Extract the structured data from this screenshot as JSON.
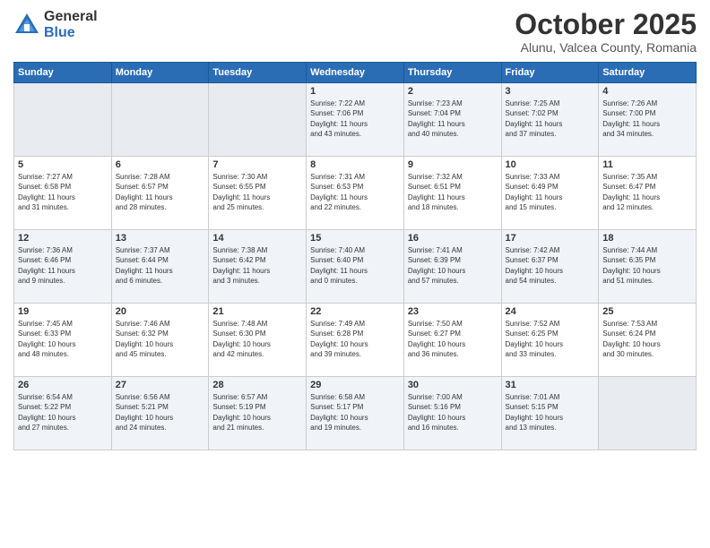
{
  "header": {
    "logo_general": "General",
    "logo_blue": "Blue",
    "month_title": "October 2025",
    "location": "Alunu, Valcea County, Romania"
  },
  "weekdays": [
    "Sunday",
    "Monday",
    "Tuesday",
    "Wednesday",
    "Thursday",
    "Friday",
    "Saturday"
  ],
  "weeks": [
    [
      {
        "day": "",
        "info": ""
      },
      {
        "day": "",
        "info": ""
      },
      {
        "day": "",
        "info": ""
      },
      {
        "day": "1",
        "info": "Sunrise: 7:22 AM\nSunset: 7:06 PM\nDaylight: 11 hours\nand 43 minutes."
      },
      {
        "day": "2",
        "info": "Sunrise: 7:23 AM\nSunset: 7:04 PM\nDaylight: 11 hours\nand 40 minutes."
      },
      {
        "day": "3",
        "info": "Sunrise: 7:25 AM\nSunset: 7:02 PM\nDaylight: 11 hours\nand 37 minutes."
      },
      {
        "day": "4",
        "info": "Sunrise: 7:26 AM\nSunset: 7:00 PM\nDaylight: 11 hours\nand 34 minutes."
      }
    ],
    [
      {
        "day": "5",
        "info": "Sunrise: 7:27 AM\nSunset: 6:58 PM\nDaylight: 11 hours\nand 31 minutes."
      },
      {
        "day": "6",
        "info": "Sunrise: 7:28 AM\nSunset: 6:57 PM\nDaylight: 11 hours\nand 28 minutes."
      },
      {
        "day": "7",
        "info": "Sunrise: 7:30 AM\nSunset: 6:55 PM\nDaylight: 11 hours\nand 25 minutes."
      },
      {
        "day": "8",
        "info": "Sunrise: 7:31 AM\nSunset: 6:53 PM\nDaylight: 11 hours\nand 22 minutes."
      },
      {
        "day": "9",
        "info": "Sunrise: 7:32 AM\nSunset: 6:51 PM\nDaylight: 11 hours\nand 18 minutes."
      },
      {
        "day": "10",
        "info": "Sunrise: 7:33 AM\nSunset: 6:49 PM\nDaylight: 11 hours\nand 15 minutes."
      },
      {
        "day": "11",
        "info": "Sunrise: 7:35 AM\nSunset: 6:47 PM\nDaylight: 11 hours\nand 12 minutes."
      }
    ],
    [
      {
        "day": "12",
        "info": "Sunrise: 7:36 AM\nSunset: 6:46 PM\nDaylight: 11 hours\nand 9 minutes."
      },
      {
        "day": "13",
        "info": "Sunrise: 7:37 AM\nSunset: 6:44 PM\nDaylight: 11 hours\nand 6 minutes."
      },
      {
        "day": "14",
        "info": "Sunrise: 7:38 AM\nSunset: 6:42 PM\nDaylight: 11 hours\nand 3 minutes."
      },
      {
        "day": "15",
        "info": "Sunrise: 7:40 AM\nSunset: 6:40 PM\nDaylight: 11 hours\nand 0 minutes."
      },
      {
        "day": "16",
        "info": "Sunrise: 7:41 AM\nSunset: 6:39 PM\nDaylight: 10 hours\nand 57 minutes."
      },
      {
        "day": "17",
        "info": "Sunrise: 7:42 AM\nSunset: 6:37 PM\nDaylight: 10 hours\nand 54 minutes."
      },
      {
        "day": "18",
        "info": "Sunrise: 7:44 AM\nSunset: 6:35 PM\nDaylight: 10 hours\nand 51 minutes."
      }
    ],
    [
      {
        "day": "19",
        "info": "Sunrise: 7:45 AM\nSunset: 6:33 PM\nDaylight: 10 hours\nand 48 minutes."
      },
      {
        "day": "20",
        "info": "Sunrise: 7:46 AM\nSunset: 6:32 PM\nDaylight: 10 hours\nand 45 minutes."
      },
      {
        "day": "21",
        "info": "Sunrise: 7:48 AM\nSunset: 6:30 PM\nDaylight: 10 hours\nand 42 minutes."
      },
      {
        "day": "22",
        "info": "Sunrise: 7:49 AM\nSunset: 6:28 PM\nDaylight: 10 hours\nand 39 minutes."
      },
      {
        "day": "23",
        "info": "Sunrise: 7:50 AM\nSunset: 6:27 PM\nDaylight: 10 hours\nand 36 minutes."
      },
      {
        "day": "24",
        "info": "Sunrise: 7:52 AM\nSunset: 6:25 PM\nDaylight: 10 hours\nand 33 minutes."
      },
      {
        "day": "25",
        "info": "Sunrise: 7:53 AM\nSunset: 6:24 PM\nDaylight: 10 hours\nand 30 minutes."
      }
    ],
    [
      {
        "day": "26",
        "info": "Sunrise: 6:54 AM\nSunset: 5:22 PM\nDaylight: 10 hours\nand 27 minutes."
      },
      {
        "day": "27",
        "info": "Sunrise: 6:56 AM\nSunset: 5:21 PM\nDaylight: 10 hours\nand 24 minutes."
      },
      {
        "day": "28",
        "info": "Sunrise: 6:57 AM\nSunset: 5:19 PM\nDaylight: 10 hours\nand 21 minutes."
      },
      {
        "day": "29",
        "info": "Sunrise: 6:58 AM\nSunset: 5:17 PM\nDaylight: 10 hours\nand 19 minutes."
      },
      {
        "day": "30",
        "info": "Sunrise: 7:00 AM\nSunset: 5:16 PM\nDaylight: 10 hours\nand 16 minutes."
      },
      {
        "day": "31",
        "info": "Sunrise: 7:01 AM\nSunset: 5:15 PM\nDaylight: 10 hours\nand 13 minutes."
      },
      {
        "day": "",
        "info": ""
      }
    ]
  ]
}
